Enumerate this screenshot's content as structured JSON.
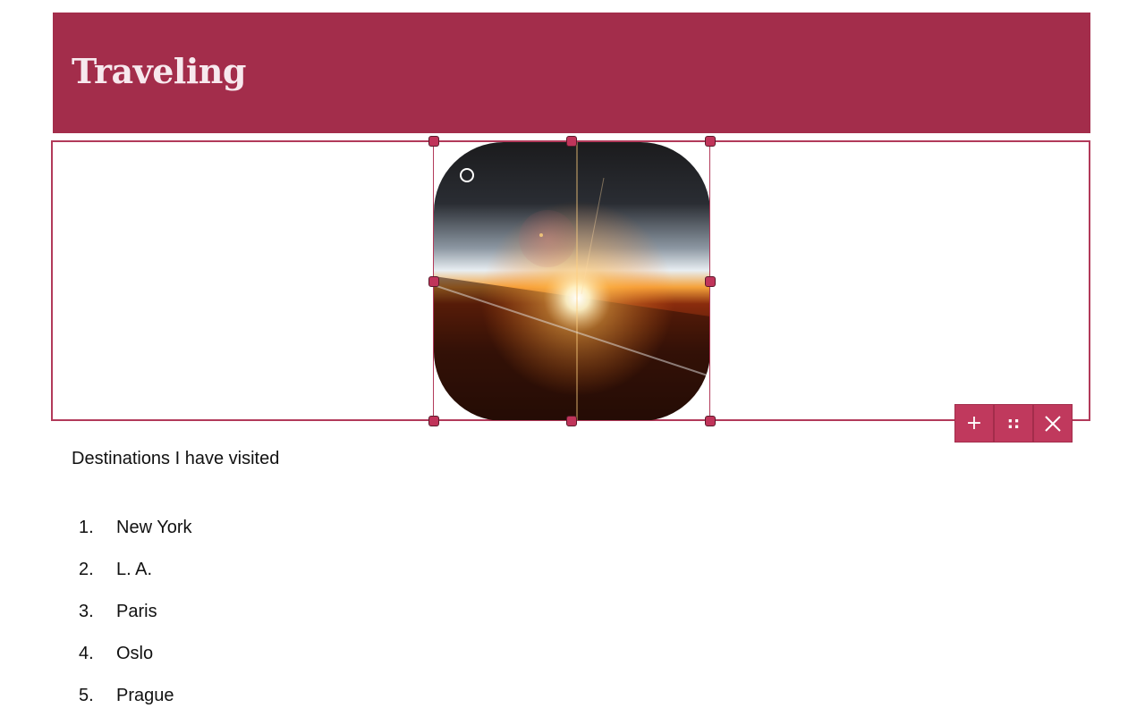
{
  "header": {
    "title": "Traveling",
    "background_color": "#a32d4b"
  },
  "image": {
    "subject": "sunrise over horizon viewed from airplane window",
    "selected": true
  },
  "toolbar": {
    "add_label": "+",
    "move_label": "::",
    "remove_label": "×",
    "accent_color": "#c0395d"
  },
  "content": {
    "caption": "Destinations I have visited",
    "destinations": [
      {
        "number": "1.",
        "name": "New York"
      },
      {
        "number": "2.",
        "name": "L. A."
      },
      {
        "number": "3.",
        "name": "Paris"
      },
      {
        "number": "4.",
        "name": "Oslo"
      },
      {
        "number": "5.",
        "name": "Prague"
      }
    ]
  }
}
